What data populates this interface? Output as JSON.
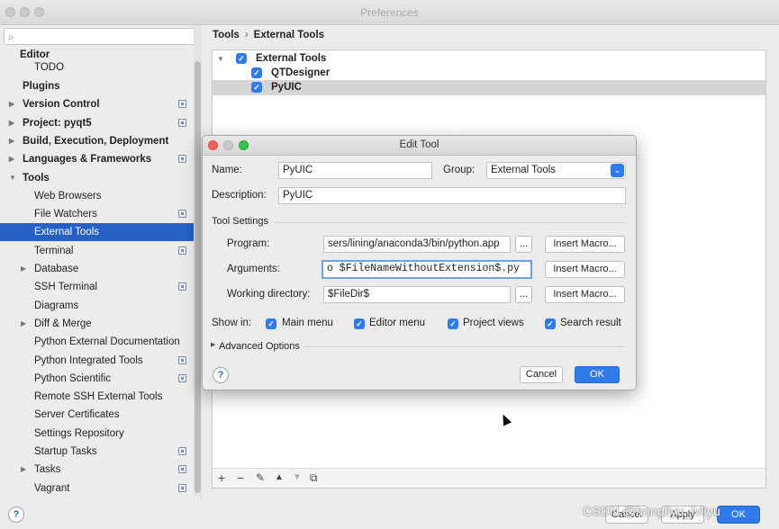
{
  "window": {
    "title": "Preferences"
  },
  "search": {
    "placeholder": ""
  },
  "sidebar": {
    "items": [
      {
        "label": "Editor",
        "bold": true,
        "indent": 0,
        "arrow": "",
        "proj": false
      },
      {
        "label": "TODO",
        "bold": false,
        "indent": 2,
        "arrow": "",
        "proj": false
      },
      {
        "label": "Plugins",
        "bold": true,
        "indent": 1,
        "arrow": "",
        "proj": false
      },
      {
        "label": "Version Control",
        "bold": true,
        "indent": 1,
        "arrow": "▶",
        "proj": true
      },
      {
        "label": "Project: pyqt5",
        "bold": true,
        "indent": 1,
        "arrow": "▶",
        "proj": true
      },
      {
        "label": "Build, Execution, Deployment",
        "bold": true,
        "indent": 1,
        "arrow": "▶",
        "proj": false
      },
      {
        "label": "Languages & Frameworks",
        "bold": true,
        "indent": 1,
        "arrow": "▶",
        "proj": true
      },
      {
        "label": "Tools",
        "bold": true,
        "indent": 1,
        "arrow": "▼",
        "proj": false
      },
      {
        "label": "Web Browsers",
        "bold": false,
        "indent": 2,
        "arrow": "",
        "proj": false
      },
      {
        "label": "File Watchers",
        "bold": false,
        "indent": 2,
        "arrow": "",
        "proj": true
      },
      {
        "label": "External Tools",
        "bold": false,
        "indent": 2,
        "arrow": "",
        "proj": false,
        "selected": true
      },
      {
        "label": "Terminal",
        "bold": false,
        "indent": 2,
        "arrow": "",
        "proj": true
      },
      {
        "label": "Database",
        "bold": false,
        "indent": 2,
        "arrow": "▶",
        "proj": false
      },
      {
        "label": "SSH Terminal",
        "bold": false,
        "indent": 2,
        "arrow": "",
        "proj": true
      },
      {
        "label": "Diagrams",
        "bold": false,
        "indent": 2,
        "arrow": "",
        "proj": false
      },
      {
        "label": "Diff & Merge",
        "bold": false,
        "indent": 2,
        "arrow": "▶",
        "proj": false
      },
      {
        "label": "Python External Documentation",
        "bold": false,
        "indent": 2,
        "arrow": "",
        "proj": false
      },
      {
        "label": "Python Integrated Tools",
        "bold": false,
        "indent": 2,
        "arrow": "",
        "proj": true
      },
      {
        "label": "Python Scientific",
        "bold": false,
        "indent": 2,
        "arrow": "",
        "proj": true
      },
      {
        "label": "Remote SSH External Tools",
        "bold": false,
        "indent": 2,
        "arrow": "",
        "proj": false
      },
      {
        "label": "Server Certificates",
        "bold": false,
        "indent": 2,
        "arrow": "",
        "proj": false
      },
      {
        "label": "Settings Repository",
        "bold": false,
        "indent": 2,
        "arrow": "",
        "proj": false
      },
      {
        "label": "Startup Tasks",
        "bold": false,
        "indent": 2,
        "arrow": "",
        "proj": true
      },
      {
        "label": "Tasks",
        "bold": false,
        "indent": 2,
        "arrow": "▶",
        "proj": true
      },
      {
        "label": "Vagrant",
        "bold": false,
        "indent": 2,
        "arrow": "",
        "proj": true
      }
    ]
  },
  "breadcrumb": {
    "part1": "Tools",
    "separator": "›",
    "part2": "External Tools"
  },
  "tools_tree": {
    "group": "External Tools",
    "items": [
      "QTDesigner",
      "PyUIC"
    ]
  },
  "toolbar": {
    "add": "+",
    "remove": "−",
    "edit": "✎",
    "up": "▲",
    "down": "▼",
    "copy": "⧉"
  },
  "footer": {
    "help": "?",
    "cancel": "Cancel",
    "apply": "Apply",
    "ok": "OK",
    "watermark": "CSDN @hongliyu_lvliyu"
  },
  "dialog": {
    "title": "Edit Tool",
    "name_label": "Name:",
    "name_value": "PyUIC",
    "group_label": "Group:",
    "group_value": "External Tools",
    "description_label": "Description:",
    "description_value": "PyUIC",
    "tool_settings_label": "Tool Settings",
    "program_label": "Program:",
    "program_value": "sers/lining/anaconda3/bin/python.app",
    "arguments_label": "Arguments:",
    "arguments_value": "o $FileNameWithoutExtension$.py",
    "working_dir_label": "Working directory:",
    "working_dir_value": "$FileDir$",
    "browse": "...",
    "insert_macro": "Insert Macro...",
    "show_in_label": "Show in:",
    "show_in": [
      "Main menu",
      "Editor menu",
      "Project views",
      "Search result"
    ],
    "advanced_label": "Advanced Options",
    "help": "?",
    "cancel": "Cancel",
    "ok": "OK"
  }
}
